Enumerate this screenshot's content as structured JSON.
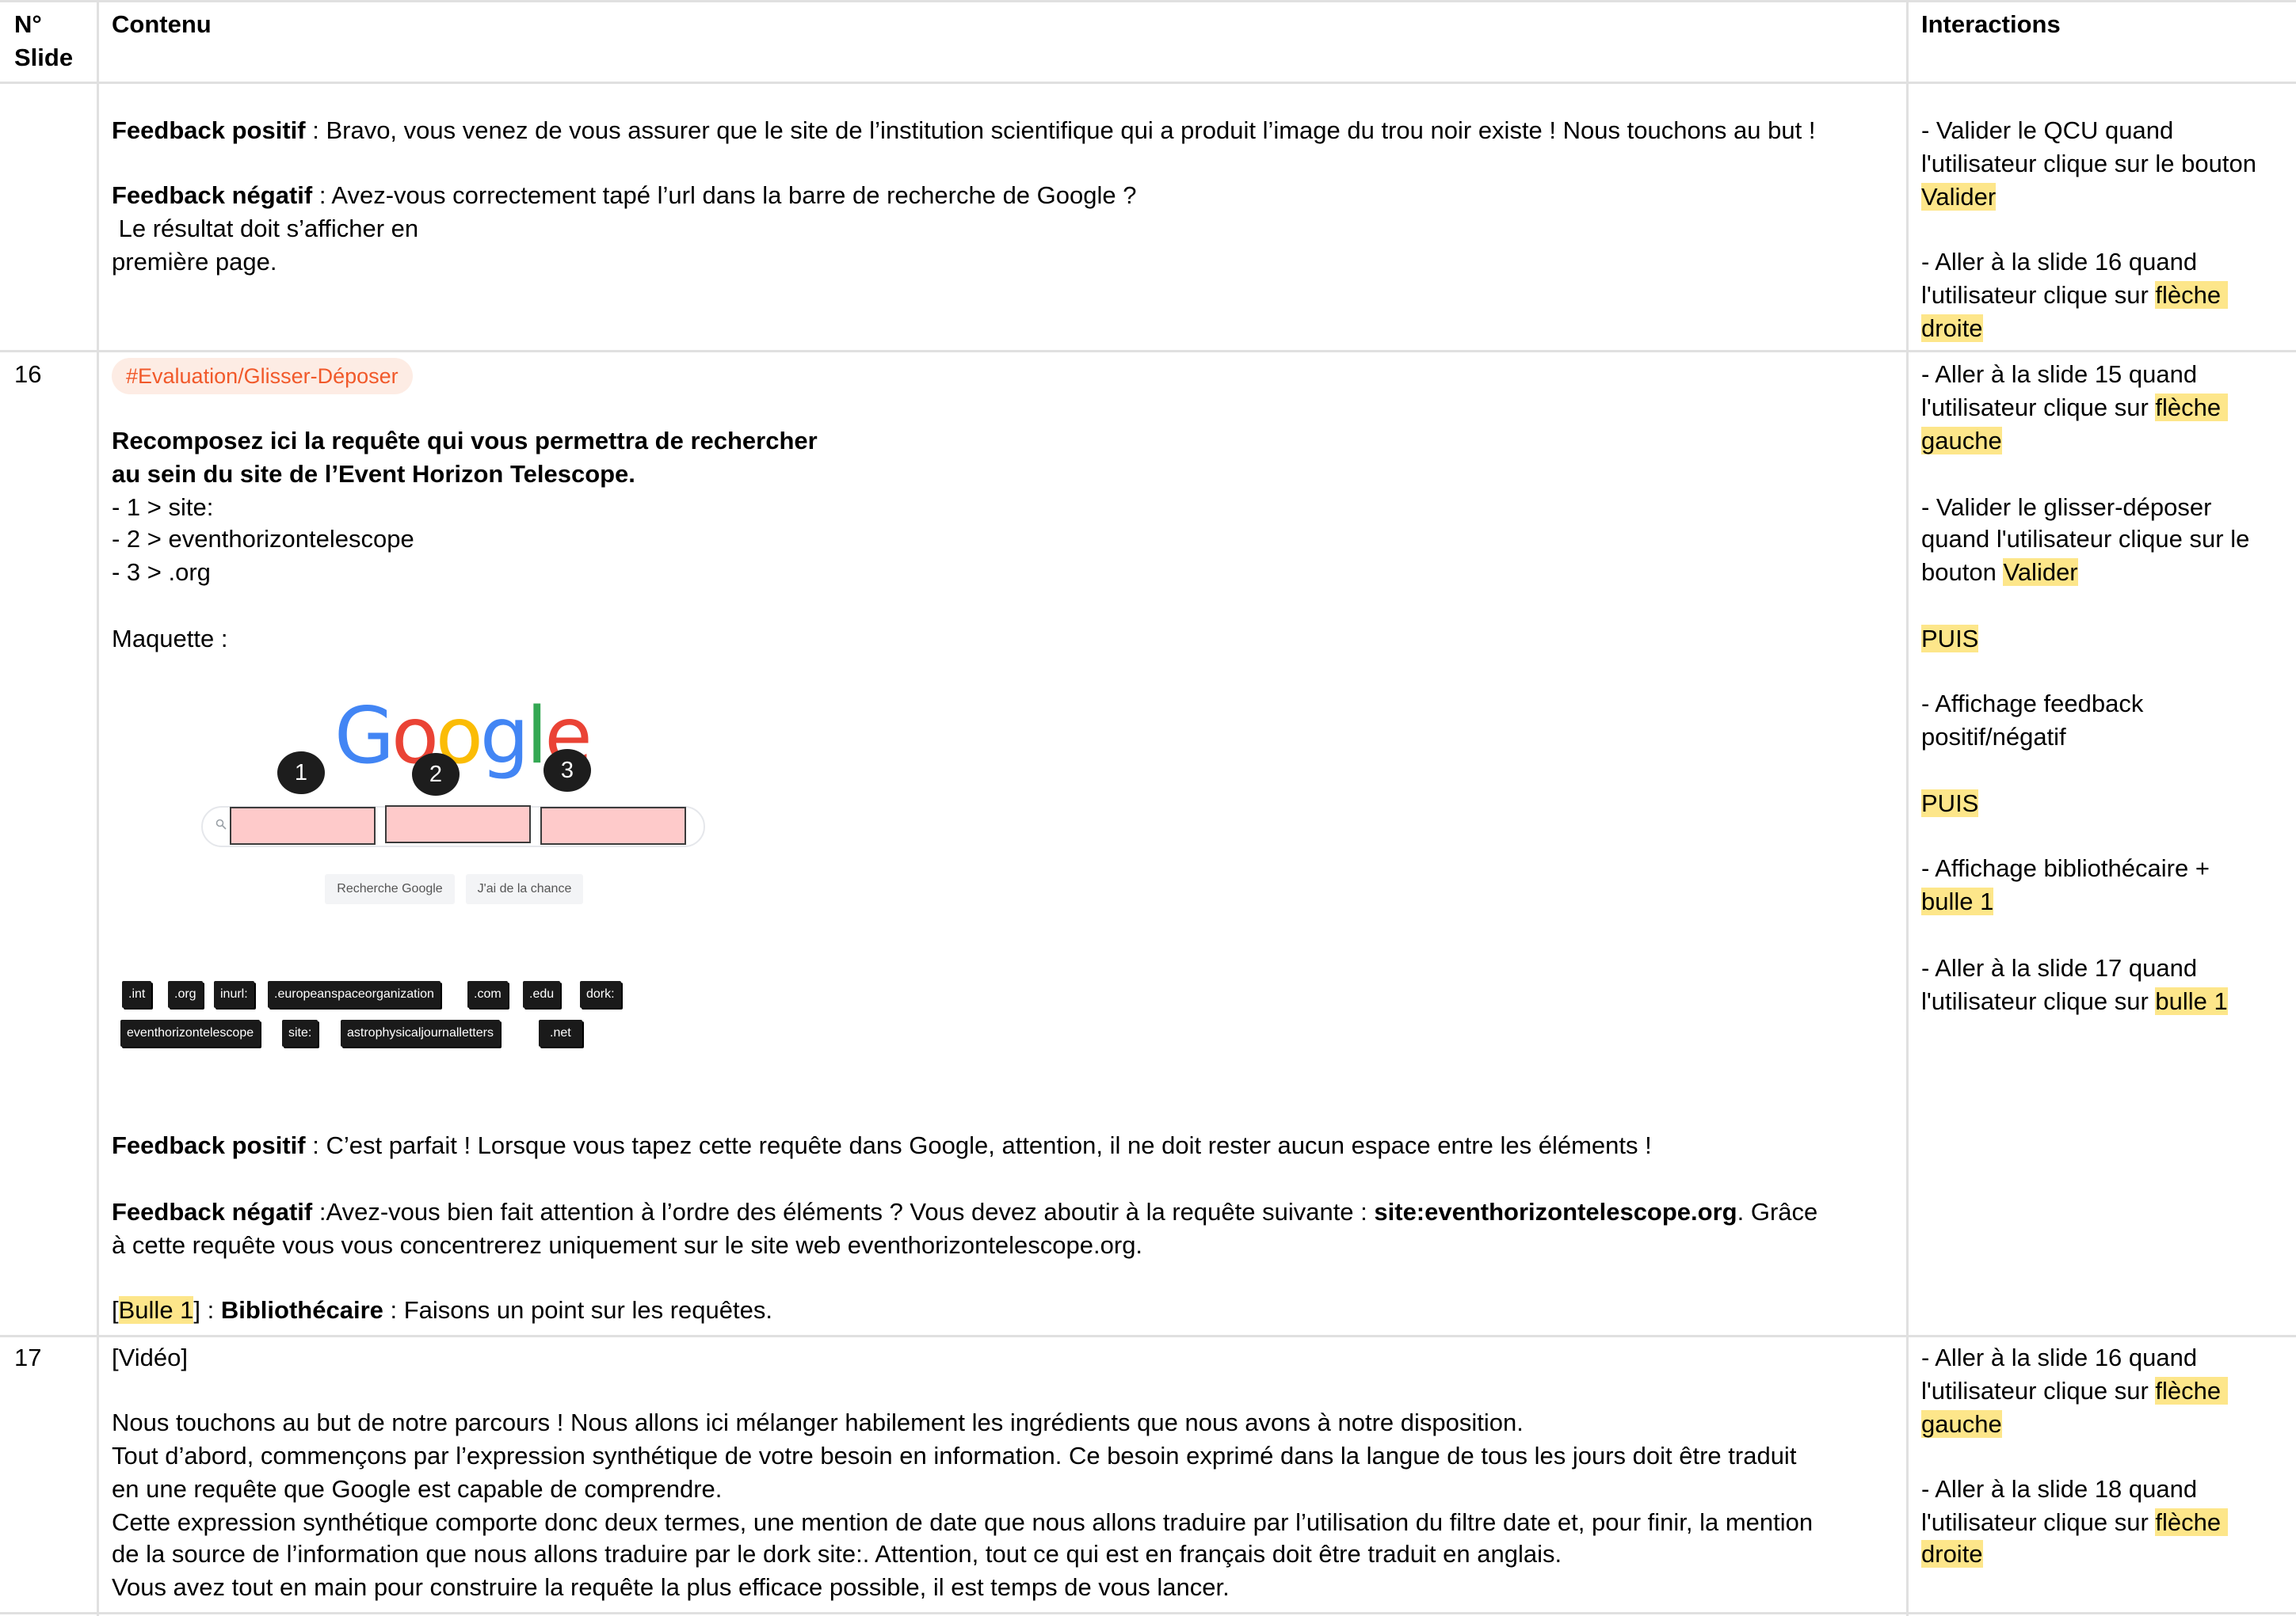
{
  "header": {
    "no_slide_line1": "N°",
    "no_slide_line2": "Slide",
    "contenu": "Contenu",
    "interactions": "Interactions"
  },
  "row_prev": {
    "feedback_pos_label": "Feedback positif",
    "feedback_pos_text": " : Bravo, vous venez de vous assurer que le site de l’institution scientifique qui a produit l’image du trou noir existe ! Nous touchons au but !",
    "feedback_neg_label": "Feedback négatif",
    "feedback_neg_text": " : Avez-vous correctement tapé l’url dans la barre de recherche de Google ?",
    "feedback_neg_line2": " Le résultat doit s’afficher en",
    "feedback_neg_line3": "première page.",
    "inter": {
      "i1_l1": "- Valider le QCU quand",
      "i1_l2": "l'utilisateur clique sur le bouton",
      "i1_hl": "Valider",
      "i2_l1": "- Aller à la slide 16 quand",
      "i2_l2": "l'utilisateur clique sur ",
      "i2_hl1": "flèche ",
      "i2_hl2": "droite"
    }
  },
  "row16": {
    "number": "16",
    "tag": "#Evaluation/Glisser-Déposer",
    "title_l1": "Recomposez ici la requête qui vous permettra de rechercher",
    "title_l2": "au sein du site de l’Event Horizon Telescope.",
    "step1": "- 1 > site:",
    "step2": "- 2 > eventhorizontelescope",
    "step3": "- 3 > .org",
    "maquette": "Maquette :",
    "mockup": {
      "logo": [
        "G",
        "o",
        "o",
        "g",
        "l",
        "e"
      ],
      "logo_colors": [
        "#4285F4",
        "#EA4335",
        "#FBBC05",
        "#4285F4",
        "#34A853",
        "#EA4335"
      ],
      "markers": [
        "1",
        "2",
        "3"
      ],
      "btn_search": "Recherche Google",
      "btn_lucky": "J'ai de la chance",
      "chips_row1": [
        ".int",
        ".org",
        "inurl:",
        ".europeanspaceorganization",
        ".com",
        ".edu",
        "dork:"
      ],
      "chips_row2": [
        "eventhorizontelescope",
        "site:",
        "astrophysicaljournalletters",
        ".net"
      ]
    },
    "feedback_pos_label": "Feedback positif",
    "feedback_pos_text": " : C’est parfait ! Lorsque vous tapez cette requête dans Google, attention, il ne doit rester aucun espace entre les éléments !",
    "feedback_neg_label": "Feedback négatif",
    "feedback_neg_text": " :Avez-vous bien fait attention à l’ordre des éléments ? Vous devez aboutir à la requête suivante : ",
    "feedback_neg_query": "site:eventhorizontelescope.org",
    "feedback_neg_after": ". Grâce",
    "feedback_neg_line2": "à cette requête vous vous concentrerez uniquement sur le site web eventhorizontelescope.org.",
    "bulle_open": "[",
    "bulle_label": "Bulle 1",
    "bulle_close": "] : ",
    "biblio_label": "Bibliothécaire",
    "biblio_text": " : Faisons un point sur les requêtes.",
    "inter": {
      "a_l1": "- Aller à la slide 15 quand",
      "a_l2": "l'utilisateur clique sur ",
      "a_hl1": "flèche ",
      "a_hl2": "gauche",
      "b_l1": "- Valider le glisser-déposer",
      "b_l2": "quand l'utilisateur clique sur le",
      "b_l3": "bouton ",
      "b_hl": "Valider",
      "puis1": "PUIS",
      "c_l1": "- Affichage feedback",
      "c_l2": "positif/négatif",
      "puis2": "PUIS",
      "d_l1": "- Affichage bibliothécaire +",
      "d_hl": "bulle 1",
      "e_l1": "- Aller à la slide 17 quand",
      "e_l2": "l'utilisateur clique sur ",
      "e_hl": "bulle 1"
    }
  },
  "row17": {
    "number": "17",
    "video": "[Vidéo]",
    "p1": "Nous touchons au but de notre parcours ! Nous allons ici mélanger habilement les ingrédients que nous avons à notre disposition.",
    "p2": "Tout d’abord, commençons par l’expression synthétique de votre besoin en information. Ce besoin exprimé dans la langue de tous les jours doit être traduit",
    "p3": "en une requête que Google est capable de comprendre.",
    "p4": "Cette expression synthétique comporte donc deux termes, une mention de date que nous allons traduire par l’utilisation du filtre date et, pour finir, la mention",
    "p5": "de la source de l’information que nous allons traduire par le dork site:. Attention, tout ce qui est en français doit être traduit en anglais.",
    "p6": "Vous avez tout en main pour construire la requête la plus efficace possible, il est temps de vous lancer.",
    "inter": {
      "a_l1": "- Aller à la slide 16 quand",
      "a_l2": "l'utilisateur clique sur ",
      "a_hl1": "flèche ",
      "a_hl2": "gauche",
      "b_l1": "- Aller à la slide 18 quand",
      "b_l2": "l'utilisateur clique sur ",
      "b_hl1": "flèche ",
      "b_hl2": "droite"
    }
  }
}
